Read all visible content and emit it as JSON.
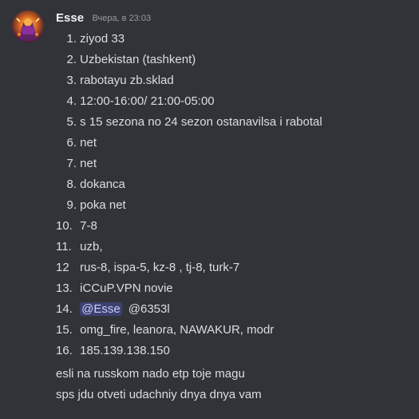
{
  "message": {
    "author": "Esse",
    "timestamp": "Вчера, в 23:03",
    "avatar_icon": "avatar-icon",
    "items": [
      {
        "num": "1.",
        "text": "ziyod 33"
      },
      {
        "num": "2.",
        "text": "Uzbekistan (tashkent)"
      },
      {
        "num": "3.",
        "text": "rabotayu zb.sklad"
      },
      {
        "num": "4.",
        "text": "12:00-16:00/ 21:00-05:00"
      },
      {
        "num": "5.",
        "text": "s 15 sezona no 24 sezon ostanavilsa i rabotal"
      },
      {
        "num": "6.",
        "text": "net"
      },
      {
        "num": "7.",
        "text": "net"
      },
      {
        "num": "8.",
        "text": "dokanca"
      },
      {
        "num": "9.",
        "text": "poka net"
      },
      {
        "num": "10.",
        "text": "7-8"
      },
      {
        "num": "11.",
        "text": "uzb,"
      },
      {
        "num": "12",
        "text": "rus-8, ispa-5, kz-8 , tj-8, turk-7"
      },
      {
        "num": "13.",
        "text": "iCCuP.VPN novie"
      },
      {
        "num": "14.",
        "mention": "@Esse",
        "text": "@6353l"
      },
      {
        "num": "15.",
        "text": "omg_fire, leanora, NAWAKUR, modr"
      },
      {
        "num": "16.",
        "text": "185.139.138.150"
      }
    ],
    "line1": "esli na russkom nado etp toje magu",
    "line2": "sps jdu otveti udachniy dnya dnya vam"
  },
  "colors": {
    "background": "#313338",
    "username": "#f2f3f5",
    "text": "#dbdee1",
    "timestamp": "#949ba4",
    "mention_bg": "rgba(88,101,242,0.3)",
    "mention_text": "#c9cdfb"
  }
}
